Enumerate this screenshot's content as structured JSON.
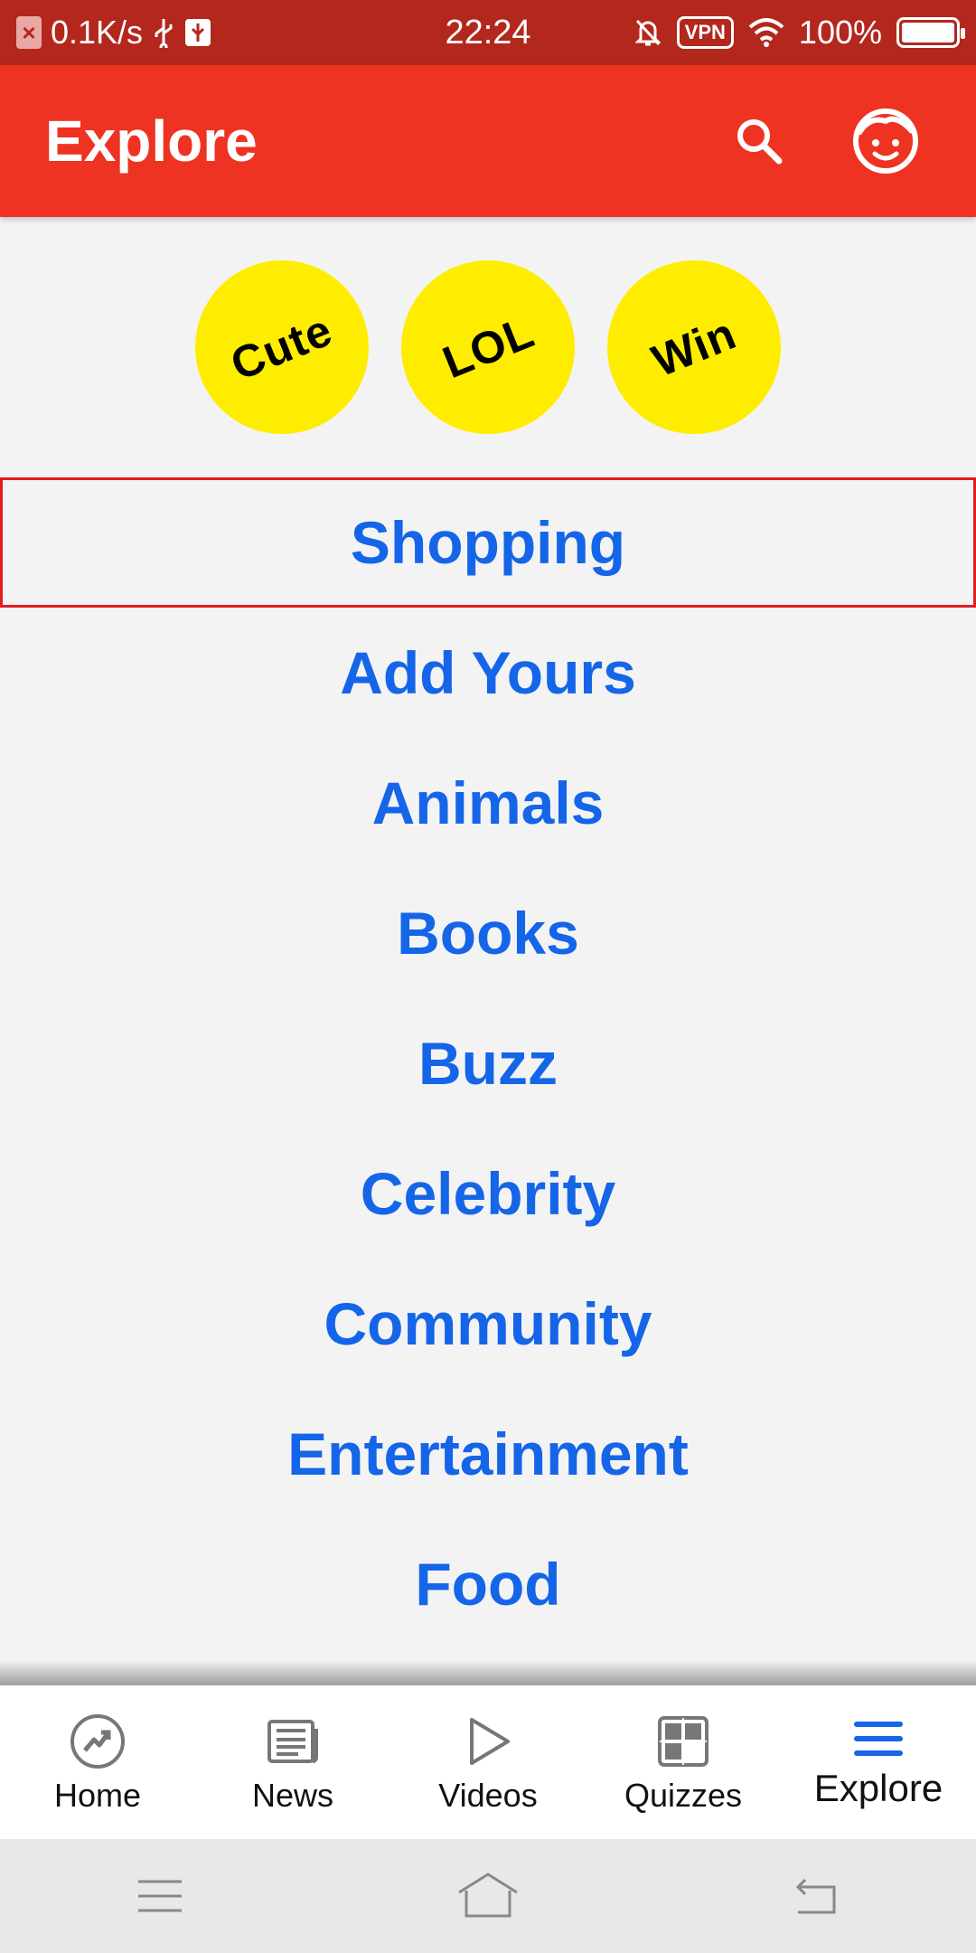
{
  "status_bar": {
    "net_speed": "0.1K/s",
    "time": "22:24",
    "vpn_label": "VPN",
    "battery": "100%"
  },
  "app_bar": {
    "title": "Explore",
    "accent_color": "#ee3322"
  },
  "badges": [
    {
      "label": "Cute"
    },
    {
      "label": "LOL"
    },
    {
      "label": "Win"
    }
  ],
  "categories": [
    {
      "label": "Shopping",
      "selected": true
    },
    {
      "label": "Add Yours"
    },
    {
      "label": "Animals"
    },
    {
      "label": "Books"
    },
    {
      "label": "Buzz"
    },
    {
      "label": "Celebrity"
    },
    {
      "label": "Community"
    },
    {
      "label": "Entertainment"
    },
    {
      "label": "Food"
    }
  ],
  "bottom_nav": [
    {
      "label": "Home",
      "icon": "trending-icon"
    },
    {
      "label": "News",
      "icon": "newspaper-icon"
    },
    {
      "label": "Videos",
      "icon": "play-icon"
    },
    {
      "label": "Quizzes",
      "icon": "grid-icon"
    },
    {
      "label": "Explore",
      "icon": "menu-icon",
      "active": true
    }
  ],
  "colors": {
    "link_blue": "#1565e8",
    "badge_yellow": "#ffed00",
    "selection_red": "#e51b1b"
  }
}
